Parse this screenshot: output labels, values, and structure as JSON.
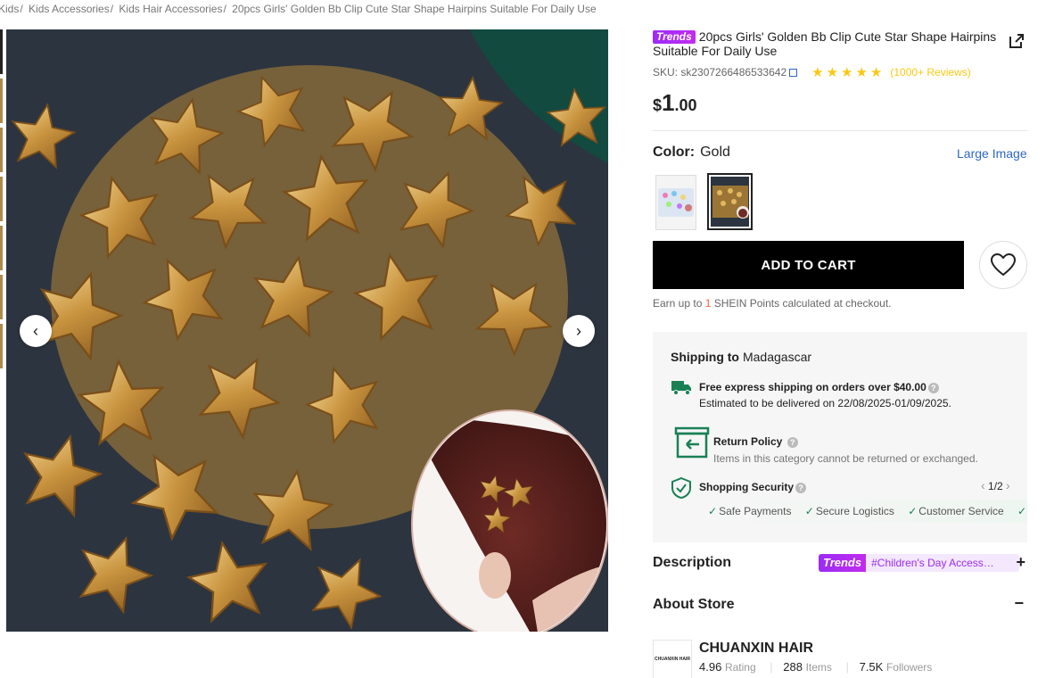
{
  "breadcrumb": {
    "items": [
      "Kids",
      "Kids Accessories",
      "Kids Hair Accessories",
      "20pcs Girls' Golden Bb Clip Cute Star Shape Hairpins Suitable For Daily Use"
    ]
  },
  "product": {
    "badge": "Trends",
    "title": "20pcs Girls' Golden Bb Clip Cute Star Shape Hairpins Suitable For Daily Use",
    "sku": "SKU: sk2307266486533642",
    "rating": 4.5,
    "stars": "★★★★★",
    "reviews": "(1000+ Reviews)",
    "price_currency": "$",
    "price_int": "1",
    "price_dec": ".00"
  },
  "color": {
    "label": "Color:",
    "value": "Gold",
    "large_image": "Large Image"
  },
  "actions": {
    "add_to_cart": "ADD TO CART"
  },
  "points": {
    "prefix": "Earn up to",
    "num": "1",
    "suffix": "SHEIN Points calculated at checkout."
  },
  "shipping": {
    "label": "Shipping to",
    "country": "Madagascar",
    "free": "Free express shipping on orders over $40.00",
    "estimate": "Estimated to be delivered on 22/08/2025-01/09/2025.",
    "return_title": "Return Policy",
    "return_desc": "Items in this category cannot be returned or exchanged.",
    "security_title": "Shopping Security",
    "pager": "1/2",
    "security_items": [
      "Safe Payments",
      "Secure Logistics",
      "Customer Service"
    ]
  },
  "description": {
    "label": "Description",
    "tag_badge": "Trends",
    "tag_text": "#Children's Day Access…"
  },
  "about": {
    "label": "About Store"
  },
  "store": {
    "logo_text": "CHUANXIN HAIR",
    "name": "CHUANXIN HAIR",
    "rating": "4.96",
    "rating_label": "Rating",
    "items": "288",
    "items_label": "Items",
    "followers": "7.5K",
    "followers_label": "Followers"
  },
  "colors": {
    "accent_purple": "#9b2cf5",
    "star_yellow": "#fac814",
    "link_blue": "#2d68c4",
    "green": "#198055",
    "orange": "#fa6338"
  }
}
